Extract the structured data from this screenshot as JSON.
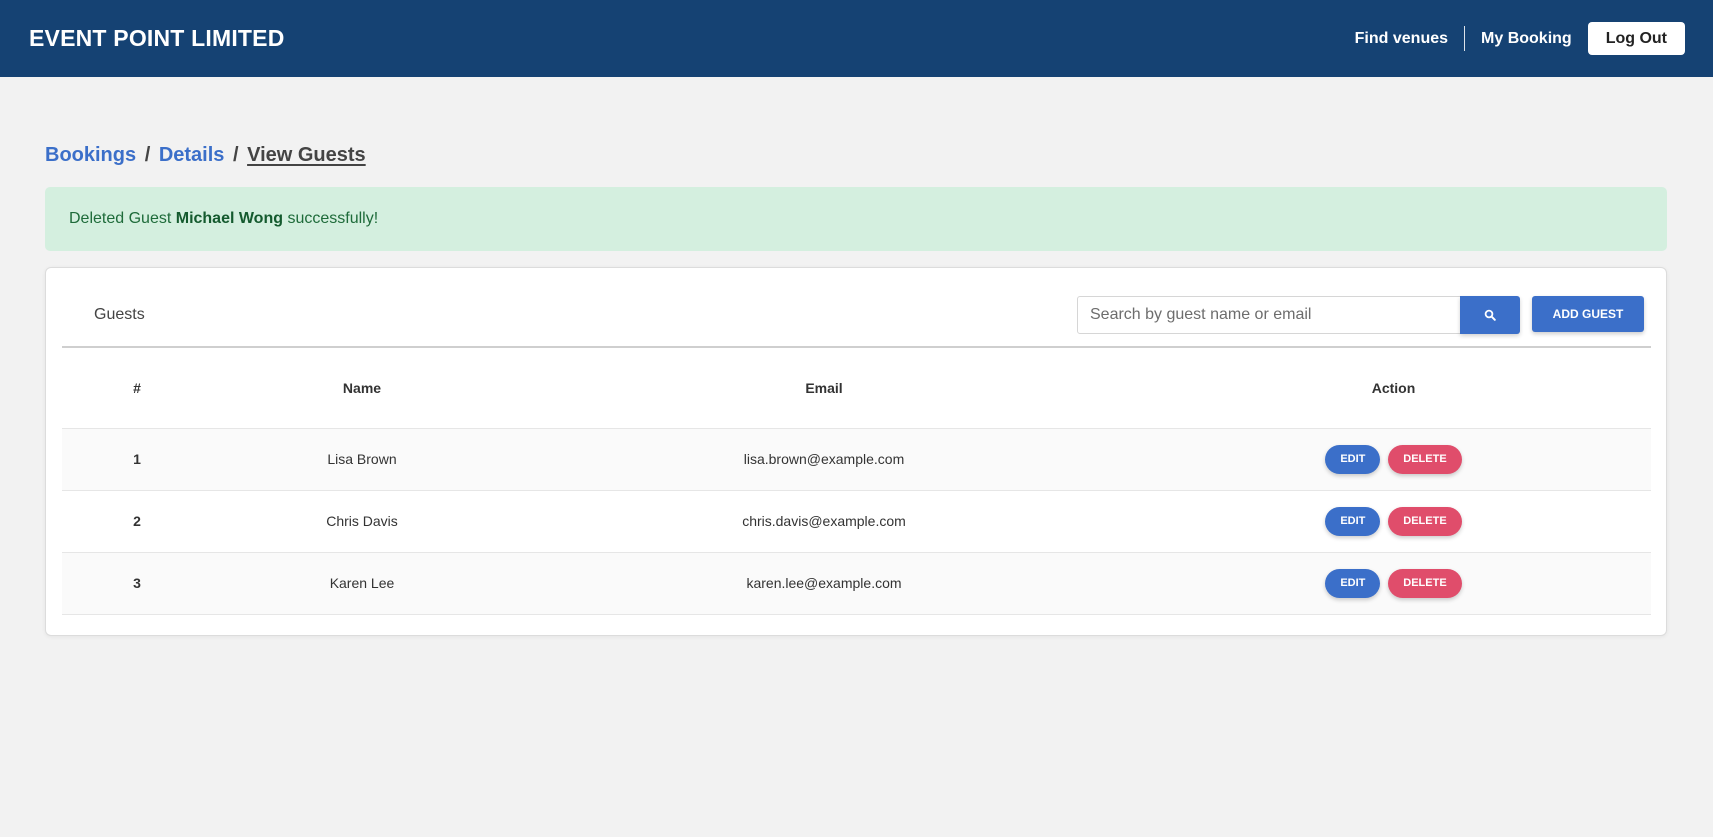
{
  "navbar": {
    "brand": "EVENT POINT LIMITED",
    "links": [
      "Find venues",
      "My Booking"
    ],
    "logout_label": "Log Out",
    "bg_color": "#154273"
  },
  "breadcrumb": {
    "items": [
      "Bookings",
      "Details"
    ],
    "separator": "/",
    "current": "View Guests"
  },
  "alert": {
    "prefix": "Deleted Guest ",
    "guest_name": "Michael Wong",
    "suffix": " successfully!",
    "bg_color": "#d4efdf"
  },
  "guests_card": {
    "title": "Guests",
    "search_placeholder": "Search by guest name or email",
    "search_icon": "search-icon",
    "add_label": "ADD GUEST"
  },
  "table": {
    "headers": [
      "#",
      "Name",
      "Email",
      "Action"
    ],
    "rows": [
      {
        "num": "1",
        "name": "Lisa Brown",
        "email": "lisa.brown@example.com"
      },
      {
        "num": "2",
        "name": "Chris Davis",
        "email": "chris.davis@example.com"
      },
      {
        "num": "3",
        "name": "Karen Lee",
        "email": "karen.lee@example.com"
      }
    ],
    "edit_label": "EDIT",
    "delete_label": "DELETE",
    "edit_color": "#3b6fc9",
    "delete_color": "#e04d6b"
  }
}
